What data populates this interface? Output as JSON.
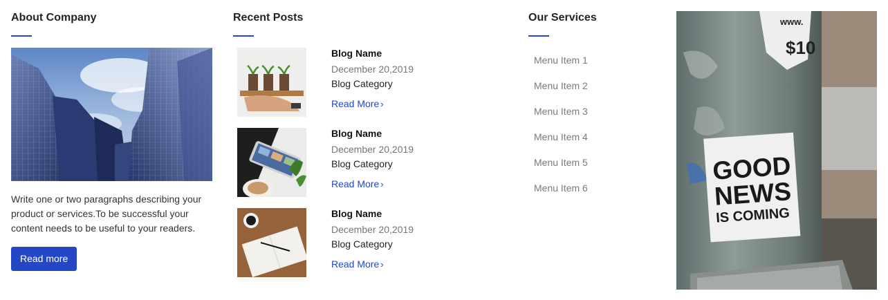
{
  "about": {
    "heading": "About Company",
    "image_alt": "glass-skyscrapers-photo",
    "text": "Write one or two paragraphs describing your product or services.To be successful your content needs to be useful to your readers.",
    "button_label": "Read more"
  },
  "posts": {
    "heading": "Recent Posts",
    "items": [
      {
        "title": "Blog Name",
        "date": "December 20,2019",
        "category": "Blog Category",
        "link": "Read More",
        "thumb": "plants-in-hands-photo"
      },
      {
        "title": "Blog Name",
        "date": "December 20,2019",
        "category": "Blog Category",
        "link": "Read More",
        "thumb": "phone-and-coffee-photo"
      },
      {
        "title": "Blog Name",
        "date": "December 20,2019",
        "category": "Blog Category",
        "link": "Read More",
        "thumb": "notebook-and-pen-photo"
      }
    ]
  },
  "services": {
    "heading": "Our Services",
    "items": [
      "Menu Item 1",
      "Menu Item 2",
      "Menu Item 3",
      "Menu Item 4",
      "Menu Item 5",
      "Menu Item 6"
    ]
  },
  "photo": {
    "sign_line1": "GOOD",
    "sign_line2": "NEWS",
    "sign_line3": "IS COMING",
    "poster_top": "$10",
    "poster_www": "www."
  },
  "colors": {
    "accent": "#2347c5",
    "heading": "#1f2328",
    "muted": "#7a7a7a"
  }
}
